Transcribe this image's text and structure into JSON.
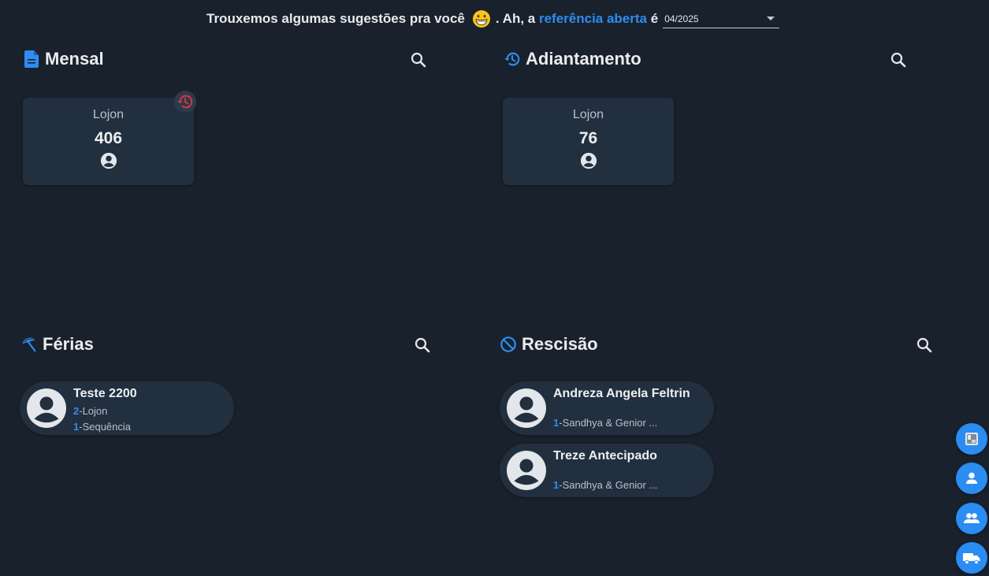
{
  "header": {
    "text_before": "Trouxemos algumas sugestões pra você",
    "text_middle": ". Ah, a ",
    "link_text": "referência aberta",
    "text_after": " é",
    "reference_value": "04/2025",
    "emoji_icon": "grinning-face-emoji-icon"
  },
  "colors": {
    "accent": "#2f8cf0",
    "background": "#19212c",
    "card": "#222f3f",
    "alert": "#d9363e"
  },
  "sections": {
    "mensal": {
      "title": "Mensal",
      "icon": "document-icon",
      "card": {
        "label": "Lojon",
        "value": "406",
        "icon": "account-circle-icon",
        "badge_icon": "history-icon"
      }
    },
    "adiantamento": {
      "title": "Adiantamento",
      "icon": "history-icon",
      "card": {
        "label": "Lojon",
        "value": "76",
        "icon": "account-circle-icon"
      }
    },
    "ferias": {
      "title": "Férias",
      "icon": "beach-umbrella-icon",
      "people": [
        {
          "name": "Teste 2200",
          "line1_num": "2",
          "line1_text": "-Lojon",
          "line2_num": "1",
          "line2_text": "-Sequência"
        }
      ]
    },
    "rescisao": {
      "title": "Rescisão",
      "icon": "block-icon",
      "people": [
        {
          "name": "Andreza Angela Feltrin",
          "line1_num": "1",
          "line1_text": "-Sandhya & Genior ..."
        },
        {
          "name": "Treze Antecipado",
          "line1_num": "1",
          "line1_text": "-Sandhya & Genior ..."
        }
      ]
    }
  },
  "fabs": [
    "report-icon",
    "person-icon",
    "group-icon",
    "truck-icon"
  ]
}
